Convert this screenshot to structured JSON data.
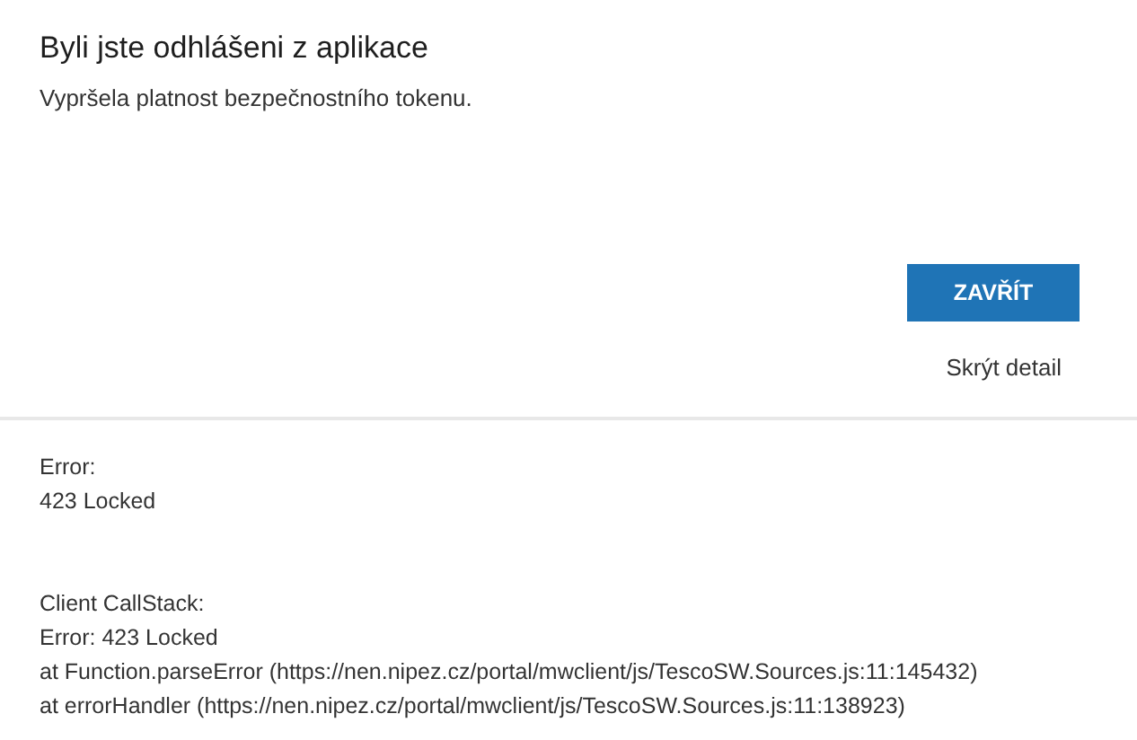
{
  "dialog": {
    "title": "Byli jste odhlášeni z aplikace",
    "message": "Vypršela platnost bezpečnostního tokenu.",
    "close_button": "ZAVŘÍT",
    "toggle_detail_link": "Skrýt detail"
  },
  "detail": {
    "sections": [
      {
        "lines": [
          "Error:",
          "423 Locked"
        ]
      },
      {
        "lines": [
          "Client CallStack:",
          "Error: 423 Locked",
          "at Function.parseError (https://nen.nipez.cz/portal/mwclient/js/TescoSW.Sources.js:11:145432)",
          "at errorHandler (https://nen.nipez.cz/portal/mwclient/js/TescoSW.Sources.js:11:138923)"
        ]
      }
    ]
  }
}
